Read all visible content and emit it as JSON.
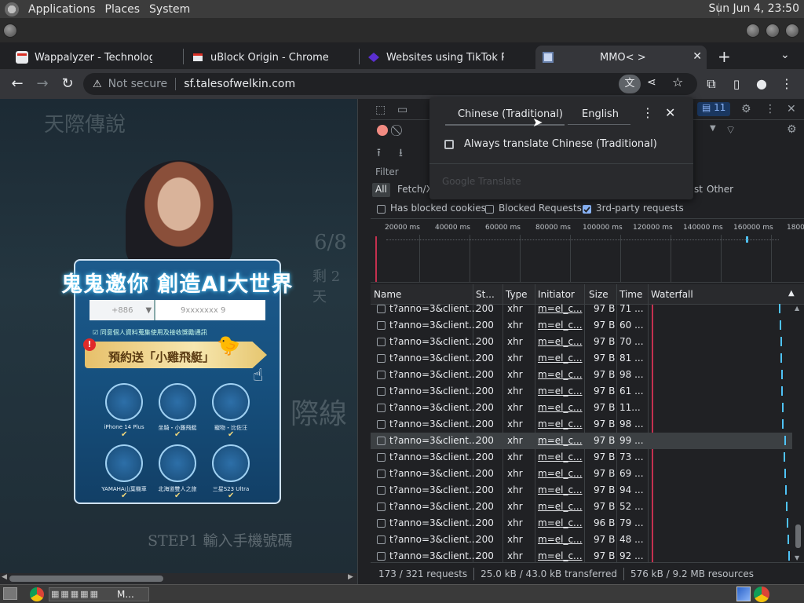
{
  "desktop": {
    "menus": [
      "Applications",
      "Places",
      "System"
    ],
    "clock": "Sun Jun  4, 23:50"
  },
  "tabs": [
    {
      "label": "Wappalyzer - Technology pro",
      "fav_color": "#e8eaed"
    },
    {
      "label": "uBlock Origin - Chrome Web",
      "fav_color": "#e8eaed"
    },
    {
      "label": "Websites using TikTok Pixel",
      "fav_color": "#5b2fd1"
    },
    {
      "label": "MMO< >",
      "fav_color": "#8ab4f8",
      "active": true
    }
  ],
  "toolbar": {
    "security": "Not secure",
    "url": "sf.talesofwelkin.com"
  },
  "page": {
    "ghost_title": "天際傳說",
    "headline": "鬼鬼邀你 創造AI大世界",
    "country_code": "+886",
    "phone_placeholder": "9xxxxxxx    9",
    "consent": "同意個人資料蒐集使用及接收獎勵通訊",
    "banner": "預約送「小雞飛艇」",
    "prizes": [
      "iPhone 14 Plus",
      "坐騎・小雞飛艇",
      "寵物・比佐汪",
      "YAMAHA山葉機車",
      "北海道雙人之旅",
      "三星S23 Ultra"
    ],
    "step": "STEP1  輸入手機號碼",
    "side_date": "6/8",
    "side_text": "剩 2 天",
    "side_big": "際線"
  },
  "devtools": {
    "badge_count": "11",
    "filter_label": "Filter",
    "chips": [
      "All",
      "Fetch/X",
      "st",
      "Other"
    ],
    "checkboxes": [
      {
        "label": "Has blocked cookies",
        "checked": false
      },
      {
        "label": "Blocked Requests",
        "checked": false
      },
      {
        "label": "3rd-party requests",
        "checked": true
      }
    ],
    "ticks": [
      "20000 ms",
      "40000 ms",
      "60000 ms",
      "80000 ms",
      "100000 ms",
      "120000 ms",
      "140000 ms",
      "160000 ms",
      "1800"
    ],
    "columns": [
      "Name",
      "St...",
      "Type",
      "Initiator",
      "Size",
      "Time",
      "Waterfall"
    ],
    "rows": [
      {
        "name": "t?anno=3&client...",
        "status": "200",
        "type": "xhr",
        "initiator": "m=el_c...",
        "size": "97 B",
        "time": "71 ..."
      },
      {
        "name": "t?anno=3&client...",
        "status": "200",
        "type": "xhr",
        "initiator": "m=el_c...",
        "size": "97 B",
        "time": "60 ..."
      },
      {
        "name": "t?anno=3&client...",
        "status": "200",
        "type": "xhr",
        "initiator": "m=el_c...",
        "size": "97 B",
        "time": "70 ..."
      },
      {
        "name": "t?anno=3&client...",
        "status": "200",
        "type": "xhr",
        "initiator": "m=el_c...",
        "size": "97 B",
        "time": "81 ..."
      },
      {
        "name": "t?anno=3&client...",
        "status": "200",
        "type": "xhr",
        "initiator": "m=el_c...",
        "size": "97 B",
        "time": "98 ..."
      },
      {
        "name": "t?anno=3&client...",
        "status": "200",
        "type": "xhr",
        "initiator": "m=el_c...",
        "size": "97 B",
        "time": "61 ..."
      },
      {
        "name": "t?anno=3&client...",
        "status": "200",
        "type": "xhr",
        "initiator": "m=el_c...",
        "size": "97 B",
        "time": "11..."
      },
      {
        "name": "t?anno=3&client...",
        "status": "200",
        "type": "xhr",
        "initiator": "m=el_c...",
        "size": "97 B",
        "time": "98 ..."
      },
      {
        "name": "t?anno=3&client...",
        "status": "200",
        "type": "xhr",
        "initiator": "m=el_c...",
        "size": "97 B",
        "time": "99 ...",
        "selected": true
      },
      {
        "name": "t?anno=3&client...",
        "status": "200",
        "type": "xhr",
        "initiator": "m=el_c...",
        "size": "97 B",
        "time": "73 ..."
      },
      {
        "name": "t?anno=3&client...",
        "status": "200",
        "type": "xhr",
        "initiator": "m=el_c...",
        "size": "97 B",
        "time": "69 ..."
      },
      {
        "name": "t?anno=3&client...",
        "status": "200",
        "type": "xhr",
        "initiator": "m=el_c...",
        "size": "97 B",
        "time": "94 ..."
      },
      {
        "name": "t?anno=3&client...",
        "status": "200",
        "type": "xhr",
        "initiator": "m=el_c...",
        "size": "97 B",
        "time": "52 ..."
      },
      {
        "name": "t?anno=3&client...",
        "status": "200",
        "type": "xhr",
        "initiator": "m=el_c...",
        "size": "96 B",
        "time": "79 ..."
      },
      {
        "name": "t?anno=3&client...",
        "status": "200",
        "type": "xhr",
        "initiator": "m=el_c...",
        "size": "97 B",
        "time": "48 ..."
      },
      {
        "name": "t?anno=3&client...",
        "status": "200",
        "type": "xhr",
        "initiator": "m=el_c...",
        "size": "97 B",
        "time": "92 ..."
      }
    ],
    "status": {
      "requests": "173 / 321 requests",
      "transferred": "25.0 kB / 43.0 kB transferred",
      "resources": "576 kB / 9.2 MB resources"
    }
  },
  "translate_popup": {
    "source_lang": "Chinese (Traditional)",
    "target_lang": "English",
    "always_label": "Always translate Chinese (Traditional)",
    "brand": "Google Translate"
  },
  "taskbar": {
    "item_label": "M..."
  }
}
